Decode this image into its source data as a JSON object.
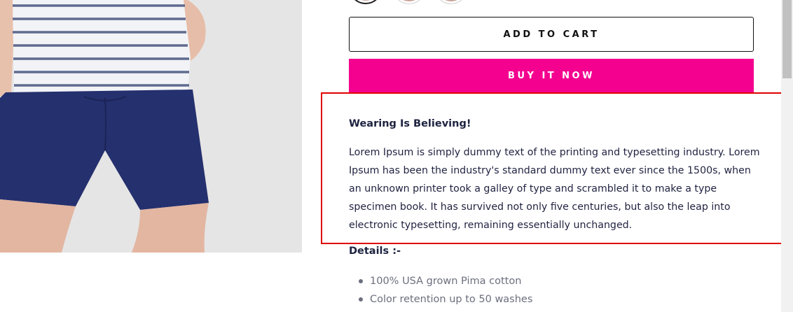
{
  "swatches": [
    {
      "selected": true
    },
    {
      "selected": false
    },
    {
      "selected": false
    }
  ],
  "buttons": {
    "add_to_cart": "ADD TO CART",
    "buy_it_now": "BUY IT NOW",
    "buy_color": "#f4028f"
  },
  "description": {
    "heading": "Wearing Is Believing!",
    "body": "Lorem Ipsum is simply dummy text of the printing and typesetting industry. Lorem Ipsum has been the industry's standard dummy text ever since the 1500s, when an unknown printer took a galley of type and scrambled it to make a type specimen book. It has survived not only five centuries, but also the leap into electronic typesetting, remaining essentially unchanged."
  },
  "details": {
    "heading": "Details :-",
    "items": [
      "100% USA grown Pima cotton",
      "Color retention up to 50 washes"
    ]
  },
  "colors": {
    "highlight_border": "#e10000",
    "heading_text": "#1d2340",
    "shorts": "#25306e"
  }
}
